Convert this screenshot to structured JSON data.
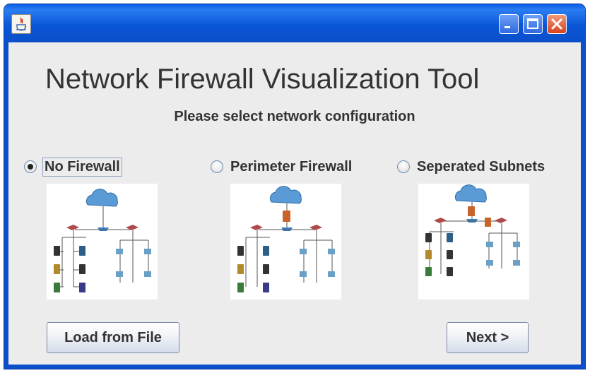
{
  "window": {
    "title": "",
    "controls": {
      "minimize": "minimize",
      "maximize": "maximize",
      "close": "close"
    }
  },
  "heading": "Network Firewall Visualization Tool",
  "subheading": "Please select network configuration",
  "options": [
    {
      "label": "No Firewall",
      "selected": true
    },
    {
      "label": "Perimeter Firewall",
      "selected": false
    },
    {
      "label": "Seperated Subnets",
      "selected": false
    }
  ],
  "buttons": {
    "load": "Load from File",
    "next": "Next >"
  },
  "colors": {
    "titlebar": "#0b55d6",
    "client_bg": "#ececec",
    "cloud": "#5b9bd5",
    "router": "#b04a4a"
  }
}
